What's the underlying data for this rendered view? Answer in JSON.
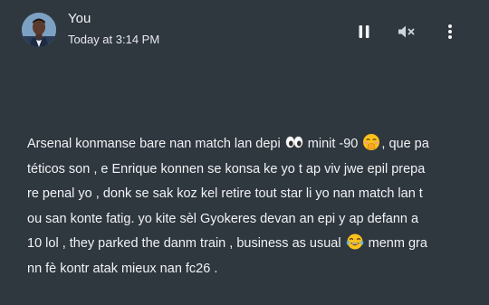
{
  "sender": {
    "name": "You",
    "timestamp": "Today at 3:14 PM"
  },
  "controls": {
    "pause_icon": "pause-icon",
    "mute_icon": "volume-mute-icon",
    "more_icon": "more-vertical-icon"
  },
  "message": {
    "line1_a": "Arsenal konmanse bare nan match lan depi",
    "line1_b": "minit -90",
    "line1_c": ", que pa",
    "line2": "téticos son , e Enrique konnen se konsa ke yo t ap viv jwe epil prepa",
    "line3": "re penal yo , donk se sak koz kel retire tout star li yo nan match lan t",
    "line4": "ou san konte fatig. yo kite sèl Gyokeres devan an epi y ap defann a",
    "line5_a": "10 lol , they parked the danm train , business as usual",
    "line5_b": "menm gra",
    "line6": "nn fè kontr atak mieux nan fc26 ."
  },
  "emoji": {
    "eyes": "eyes-emoji",
    "hand_over_mouth": "face-with-hand-over-mouth-emoji",
    "tears_of_joy": "face-with-tears-of-joy-emoji"
  }
}
